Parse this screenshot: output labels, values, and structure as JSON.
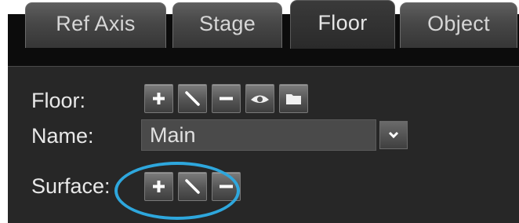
{
  "tabs": [
    {
      "label": "Ref Axis",
      "active": false
    },
    {
      "label": "Stage",
      "active": false
    },
    {
      "label": "Floor",
      "active": true
    },
    {
      "label": "Object",
      "active": false
    }
  ],
  "floor_row": {
    "label": "Floor:",
    "buttons": [
      "add-icon",
      "edit-icon",
      "remove-icon",
      "eye-icon",
      "folder-icon"
    ]
  },
  "name_row": {
    "label": "Name:",
    "value": "Main"
  },
  "surface_row": {
    "label": "Surface:",
    "buttons": [
      "add-icon",
      "edit-icon",
      "remove-icon"
    ]
  },
  "colors": {
    "highlight_circle": "#2ea7dd",
    "panel_bg": "#272727",
    "tab_bg": "#474747"
  }
}
